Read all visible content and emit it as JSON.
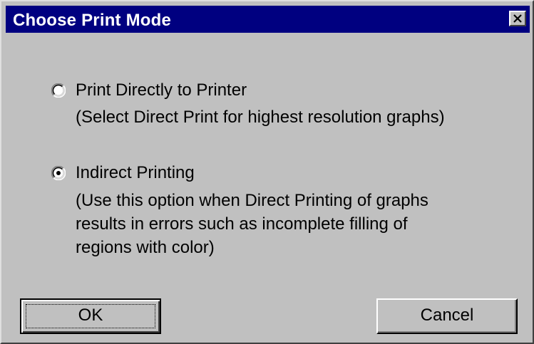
{
  "dialog": {
    "title": "Choose Print Mode",
    "close_icon": "close-icon"
  },
  "options": [
    {
      "label": "Print Directly to Printer",
      "selected": false,
      "description": "(Select Direct Print for highest resolution graphs)"
    },
    {
      "label": "Indirect Printing",
      "selected": true,
      "description": "(Use this option when Direct Printing of graphs\nresults in errors such as incomplete filling of\nregions with color)"
    }
  ],
  "buttons": {
    "ok_label": "OK",
    "cancel_label": "Cancel"
  },
  "colors": {
    "titlebar": "#000080",
    "face": "#c0c0c0"
  }
}
